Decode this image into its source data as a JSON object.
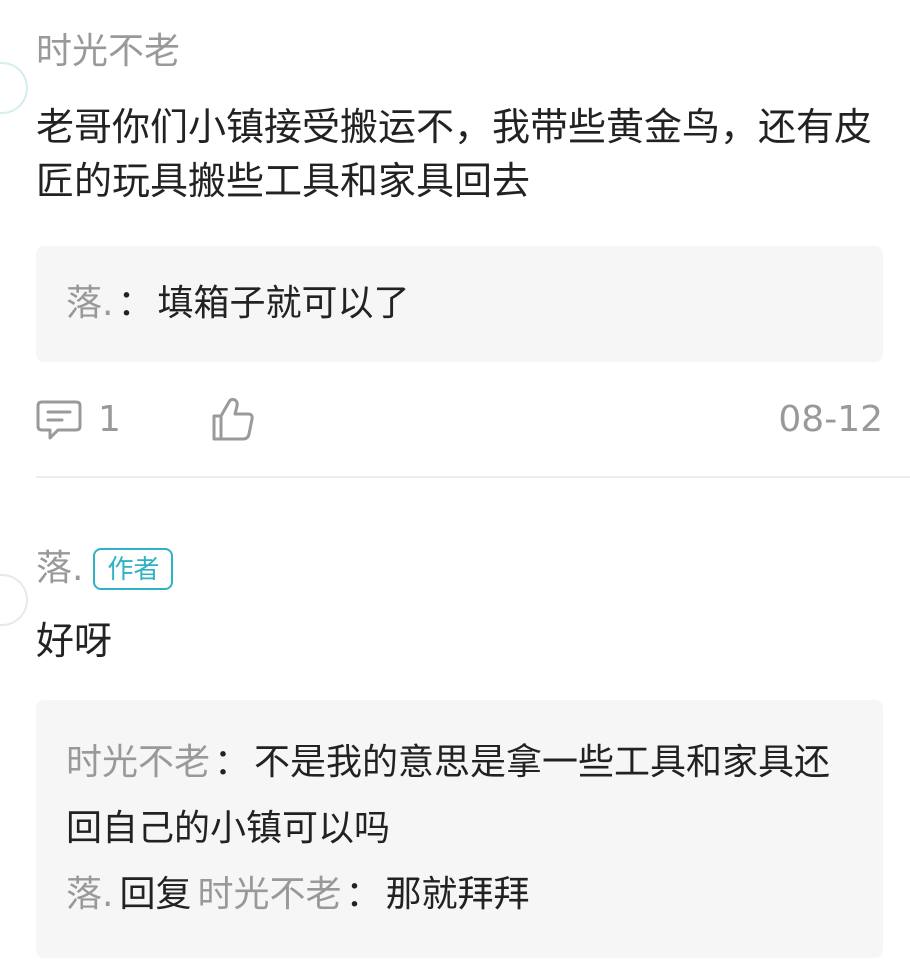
{
  "comment1": {
    "username": "时光不老",
    "text": "老哥你们小镇接受搬运不，我带些黄金鸟，还有皮匠的玩具搬些工具和家具回去",
    "reply": {
      "user": "落.",
      "colon": "：",
      "text": "填箱子就可以了"
    },
    "actions": {
      "comment_count": "1",
      "date": "08-12"
    }
  },
  "comment2": {
    "username": "落.",
    "badge": "作者",
    "text": "好呀",
    "replies": [
      {
        "user": "时光不老",
        "colon": "：",
        "text": "不是我的意思是拿一些工具和家具还回自己的小镇可以吗"
      },
      {
        "user": "落.",
        "reply_word": "回复",
        "target": "时光不老",
        "colon": "：",
        "text": "那就拜拜"
      }
    ]
  },
  "icons": {
    "comment": "comment-icon",
    "like": "thumbs-up-icon"
  },
  "colors": {
    "accent": "#2fb3c4",
    "muted": "#999999",
    "text": "#222222",
    "reply_bg": "#f6f6f6"
  }
}
